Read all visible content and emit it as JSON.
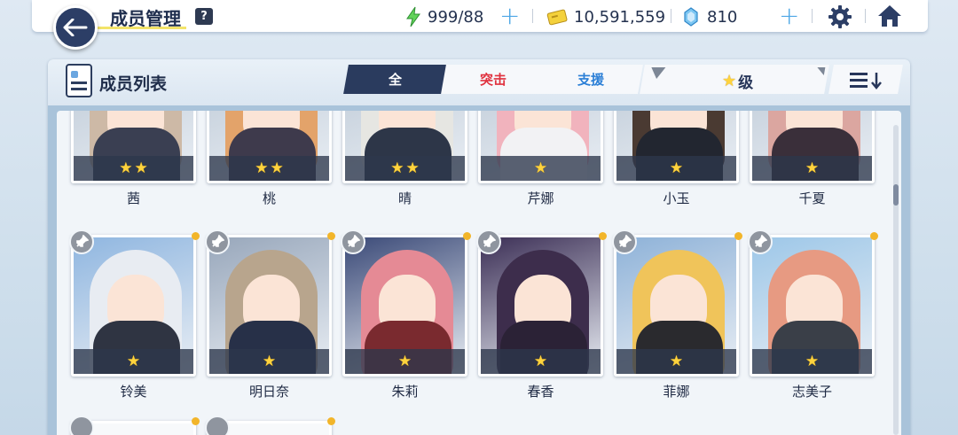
{
  "header": {
    "title": "成员管理",
    "help_label": "?",
    "stamina": "999/88",
    "credits": "10,591,559",
    "gems": "810"
  },
  "panel": {
    "title": "成员列表",
    "tabs": [
      {
        "label": "全",
        "active": true
      },
      {
        "label": "突击",
        "color": "#e0323f"
      },
      {
        "label": "支援",
        "color": "#2b7fd6"
      }
    ],
    "sort_label": "级"
  },
  "rows": [
    {
      "members": [
        {
          "name": "茜",
          "stars": 2,
          "hair": "#cdb9a6",
          "body": "#3a3f52"
        },
        {
          "name": "桃",
          "stars": 2,
          "hair": "#e3a36a",
          "body": "#3e3a4c"
        },
        {
          "name": "晴",
          "stars": 2,
          "hair": "#e6e6e2",
          "body": "#2d3648"
        },
        {
          "name": "芹娜",
          "stars": 1,
          "hair": "#f1b3bd",
          "body": "#f2f2f4"
        },
        {
          "name": "小玉",
          "stars": 1,
          "hair": "#4a3a32",
          "body": "#222630"
        },
        {
          "name": "千夏",
          "stars": 1,
          "hair": "#dba6a0",
          "body": "#3a2f3a"
        }
      ]
    },
    {
      "members": [
        {
          "name": "铃美",
          "stars": 1,
          "hair": "#e8ecf2",
          "body": "#2f3442",
          "bg": "#8fb6e0"
        },
        {
          "name": "明日奈",
          "stars": 1,
          "hair": "#b8a58d",
          "body": "#273048",
          "bg": "#98a7bb"
        },
        {
          "name": "朱莉",
          "stars": 1,
          "hair": "#e58a95",
          "body": "#7a2a2f",
          "bg": "#3b4a78"
        },
        {
          "name": "春香",
          "stars": 1,
          "hair": "#3d2d4c",
          "body": "#2b2236",
          "bg": "#3c2f56"
        },
        {
          "name": "菲娜",
          "stars": 1,
          "hair": "#f0c45a",
          "body": "#2a2a2e",
          "bg": "#8eb2d8"
        },
        {
          "name": "志美子",
          "stars": 1,
          "hair": "#e79a82",
          "body": "#3a3f48",
          "bg": "#9dc7e8"
        }
      ]
    }
  ]
}
